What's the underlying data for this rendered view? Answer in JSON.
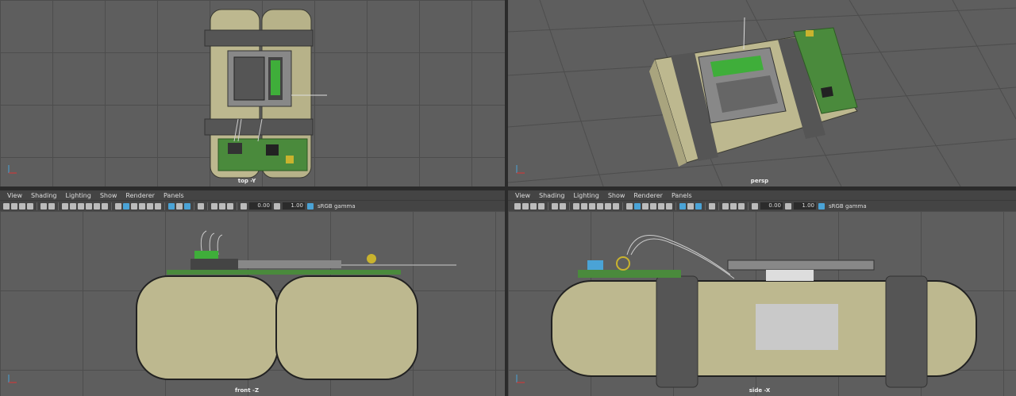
{
  "viewports": {
    "top": {
      "camera": "top -Y"
    },
    "persp": {
      "camera": "persp"
    },
    "front": {
      "camera": "front -Z"
    },
    "side": {
      "camera": "side -X"
    }
  },
  "panel_menu": [
    "View",
    "Shading",
    "Lighting",
    "Show",
    "Renderer",
    "Panels"
  ],
  "panel_toolbar": {
    "exposure": "0.00",
    "gamma": "1.00",
    "color_space": "sRGB gamma"
  },
  "colors": {
    "viewport_bg": "#5e5e5e",
    "grid": "#4d4d4d",
    "charge": "#bdb88f",
    "strap": "#555555",
    "pcb": "#4a8a3c",
    "screen": "#3fae3a",
    "highlight": "#4aa3d6"
  },
  "icons": [
    "select-camera-icon",
    "grid-icon",
    "wireframe-icon",
    "smooth-shade-icon",
    "texture-icon",
    "light-icon",
    "shadow-icon",
    "isolate-icon",
    "xray-icon",
    "exposure-icon",
    "gamma-icon",
    "color-management-icon"
  ]
}
